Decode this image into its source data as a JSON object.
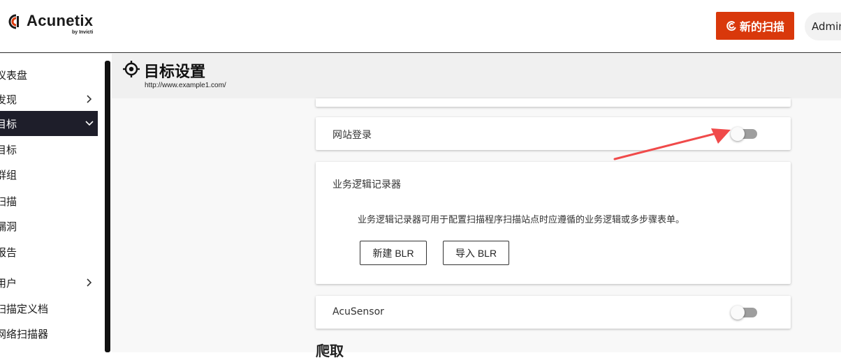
{
  "brand": {
    "name": "Acunetix",
    "byline": "by Invicti",
    "accent": "#d9380b"
  },
  "header": {
    "new_scan_label": "新的扫描",
    "user_label": "Admin"
  },
  "sidebar": {
    "items": [
      {
        "label": "仪表盘",
        "chevron": "none"
      },
      {
        "label": "发现",
        "chevron": "right"
      },
      {
        "label": "目标",
        "chevron": "down",
        "active": true
      },
      {
        "label": "目标",
        "chevron": "none"
      },
      {
        "label": "群组",
        "chevron": "none"
      },
      {
        "label": "扫描",
        "chevron": "none"
      },
      {
        "label": "漏洞",
        "chevron": "none"
      },
      {
        "label": "报告",
        "chevron": "none"
      },
      {
        "label": "用户",
        "chevron": "right"
      },
      {
        "label": "扫描定义档",
        "chevron": "none"
      },
      {
        "label": "网络扫描器",
        "chevron": "none"
      }
    ]
  },
  "page": {
    "title": "目标设置",
    "url": "http://www.example1.com/"
  },
  "settings": {
    "site_login": {
      "label": "网站登录",
      "enabled": false
    },
    "blr": {
      "title": "业务逻辑记录器",
      "description": "业务逻辑记录器可用于配置扫描程序扫描站点时应遵循的业务逻辑或多步骤表单。",
      "new_button": "新建 BLR",
      "import_button": "导入 BLR"
    },
    "acusensor": {
      "label": "AcuSensor",
      "enabled": false
    },
    "next_section": "爬取"
  },
  "annotation": {
    "arrow_color": "#f04a4a"
  }
}
